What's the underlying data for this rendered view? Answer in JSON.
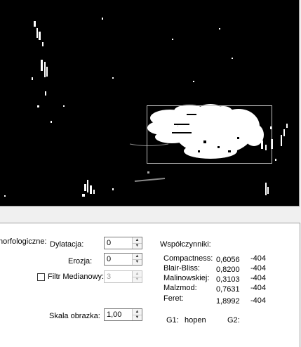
{
  "image_panel": {},
  "morphology": {
    "group_label": "norfologiczne:",
    "dilation": {
      "label": "Dylatacja:",
      "value": "0"
    },
    "erosion": {
      "label": "Erozja:",
      "value": "0"
    },
    "median_filter": {
      "label": "Filtr Medianowy:",
      "checked": false,
      "value": "3"
    },
    "scale": {
      "label": "Skala obrazka:",
      "value": "1,00"
    }
  },
  "coefficients": {
    "title": "Współczynniki:",
    "rows": [
      {
        "name": "Compactness:",
        "value": "0,6056",
        "ref": "-404"
      },
      {
        "name": "Blair-Bliss:",
        "value": "0,8200",
        "ref": "-404"
      },
      {
        "name": "Malinowskiej:",
        "value": "0,3103",
        "ref": "-404"
      },
      {
        "name": "Malzmod:",
        "value": "0,7631",
        "ref": "-404"
      },
      {
        "name": "Feret:",
        "value": "1,8992",
        "ref": "-404"
      }
    ],
    "g1_label": "G1:",
    "g1_value": "hopen",
    "g2_label": "G2:"
  },
  "icons": {
    "spin_up": "arrow-up",
    "spin_down": "arrow-down"
  }
}
